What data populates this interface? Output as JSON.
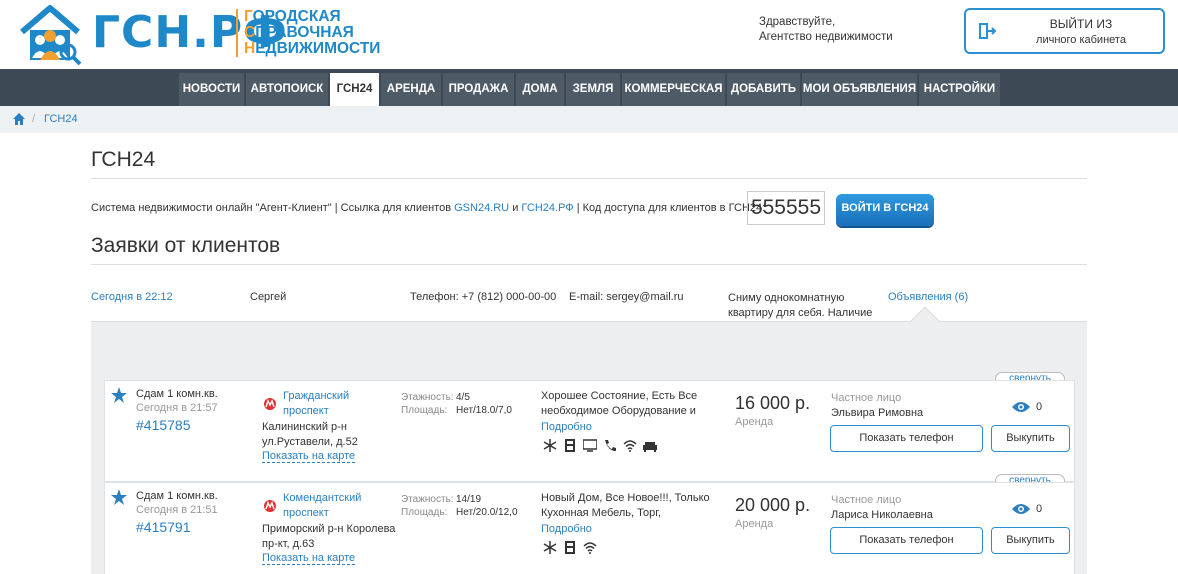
{
  "logo": {
    "text": "ГСН.РФ",
    "sub": [
      "ГОРОДСКАЯ",
      "СПРАВОЧНАЯ",
      "НЕДВИЖИМОСТИ"
    ]
  },
  "greeting": {
    "line1": "Здравствуйте,",
    "line2": "Агентство недвижимости"
  },
  "logout": {
    "line1": "ВЫЙТИ ИЗ",
    "line2": "личного кабинета"
  },
  "nav": [
    "НОВОСТИ",
    "АВТОПОИСК",
    "ГСН24",
    "АРЕНДА",
    "ПРОДАЖА",
    "ДОМА",
    "ЗЕМЛЯ",
    "КОММЕРЧЕСКАЯ",
    "ДОБАВИТЬ",
    "МОИ ОБЪЯВЛЕНИЯ",
    "НАСТРОЙКИ"
  ],
  "nav_active": "ГСН24",
  "breadcrumb": {
    "sep": "/",
    "current": "ГСН24"
  },
  "page_title": "ГСН24",
  "system": {
    "text1": "Система недвижимости онлайн \"Агент-Клиент\" | Ссылка для клиентов",
    "link1": "GSN24.RU",
    "and": "и",
    "link2": "ГСН24.РФ",
    "text2": "| Код доступа для клиентов в ГСН24:",
    "code": "555555",
    "enter_button": "ВОЙТИ В ГСН24"
  },
  "requests_title": "Заявки от клиентов",
  "request": {
    "time": "Сегодня в 22:12",
    "name": "Сергей",
    "phone": "Телефон: +7 (812) 000-00-00",
    "email": "E-mail: sergey@mail.ru",
    "text": "Сниму однокомнатную квартиру для себя. Наличие",
    "listings_link": "Объявления (6)"
  },
  "listings": [
    {
      "collapse": "свернуть",
      "title": "Сдам 1 комн.кв.",
      "date": "Сегодня в 21:57",
      "number": "#415785",
      "station": "Гражданский проспект",
      "address": "Калининский р-н ул.Руставели, д.52",
      "map_link": "Показать на карте",
      "floors_label": "Этажность:",
      "floors": "4/5",
      "area_label": "Площадь:",
      "area": "Нет/18.0/7,0",
      "description": "Хорошее Состояние, Есть Все необходимое Оборудование и",
      "more": "Подробно",
      "amenities": [
        "snowflake-icon",
        "fridge-icon",
        "tv-icon",
        "phone-icon",
        "wifi-icon",
        "sofa-icon"
      ],
      "price": "16 000 р.",
      "price_type": "Аренда",
      "seller_type": "Частное лицо",
      "seller": "Эльвира Римовна",
      "views": "0",
      "phone_button": "Показать телефон",
      "buy_button": "Выкупить"
    },
    {
      "collapse": "свернуть",
      "title": "Сдам 1 комн.кв.",
      "date": "Сегодня в 21:51",
      "number": "#415791",
      "station": "Комендантский проспект",
      "address": "Приморский р-н Королева пр-кт, д.63",
      "map_link": "Показать на карте",
      "floors_label": "Этажность:",
      "floors": "14/19",
      "area_label": "Площадь:",
      "area": "Нет/20.0/12,0",
      "description": "Новый Дом, Все Новое!!!, Только Кухонная Мебель, Торг,",
      "more": "Подробно",
      "amenities": [
        "snowflake-icon",
        "fridge-icon",
        "wifi-icon"
      ],
      "price": "20 000 р.",
      "price_type": "Аренда",
      "seller_type": "Частное лицо",
      "seller": "Лариса Николаевна",
      "views": "0",
      "phone_button": "Показать телефон",
      "buy_button": "Выкупить"
    }
  ],
  "colors": {
    "accent": "#1e88c8",
    "logo_orange": "#f0a030",
    "nav_bg": "#3d4a55",
    "nav_item": "#4e5b67"
  }
}
